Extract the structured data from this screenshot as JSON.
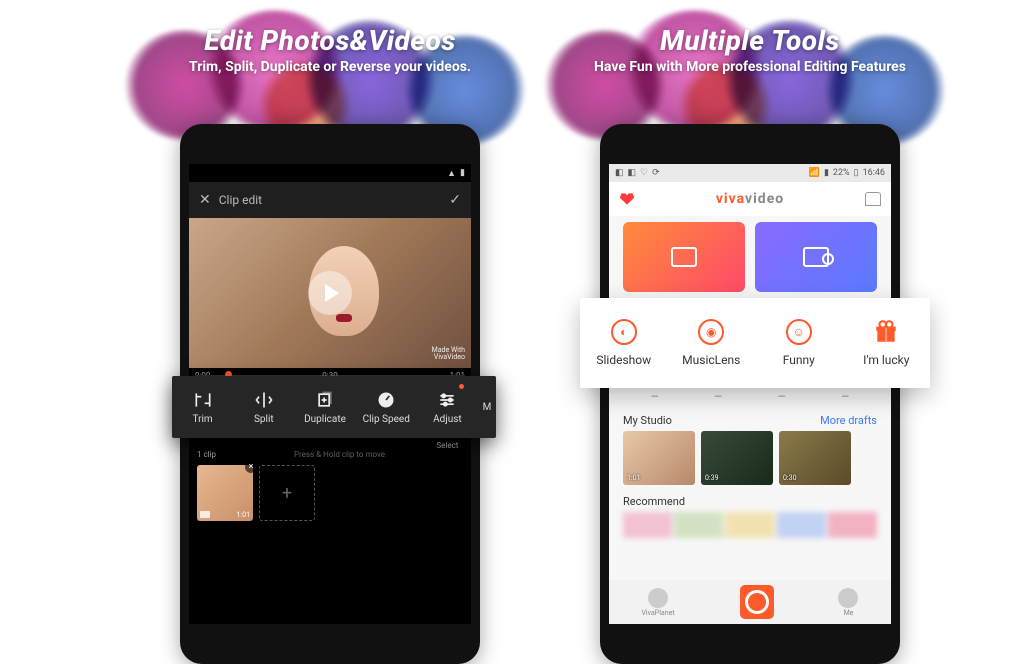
{
  "left": {
    "headline": "Edit Photos&Videos",
    "subhead": "Trim, Split, Duplicate or Reverse your videos.",
    "appbar_title": "Clip edit",
    "watermark_line1": "Made With",
    "watermark_line2": "VivaVideo",
    "timeline_start": "0:00",
    "timeline_mid": "0:30",
    "timeline_end": "1:01",
    "tools": {
      "trim": "Trim",
      "split": "Split",
      "duplicate": "Duplicate",
      "clipspeed": "Clip Speed",
      "adjust": "Adjust",
      "adjust_sub": "Select",
      "more": "M"
    },
    "clip_count": "1 clip",
    "clip_hint": "Press & Hold clip to move",
    "clip_duration": "1:01"
  },
  "right": {
    "headline": "Multiple Tools",
    "subhead": "Have Fun with More professional Editing Features",
    "status_signal": "22%",
    "status_time": "16:46",
    "brand_1": "viva",
    "brand_2": "video",
    "popup": {
      "slideshow": "Slideshow",
      "musiclens": "MusicLens",
      "funny": "Funny",
      "lucky": "I'm lucky"
    },
    "studio_title": "My Studio",
    "studio_more": "More drafts",
    "studio": [
      {
        "dur": "1:01"
      },
      {
        "dur": "0:39"
      },
      {
        "dur": "0:30"
      }
    ],
    "recommend_title": "Recommend",
    "nav": {
      "planet": "VivaPlanet",
      "me": "Me"
    }
  }
}
